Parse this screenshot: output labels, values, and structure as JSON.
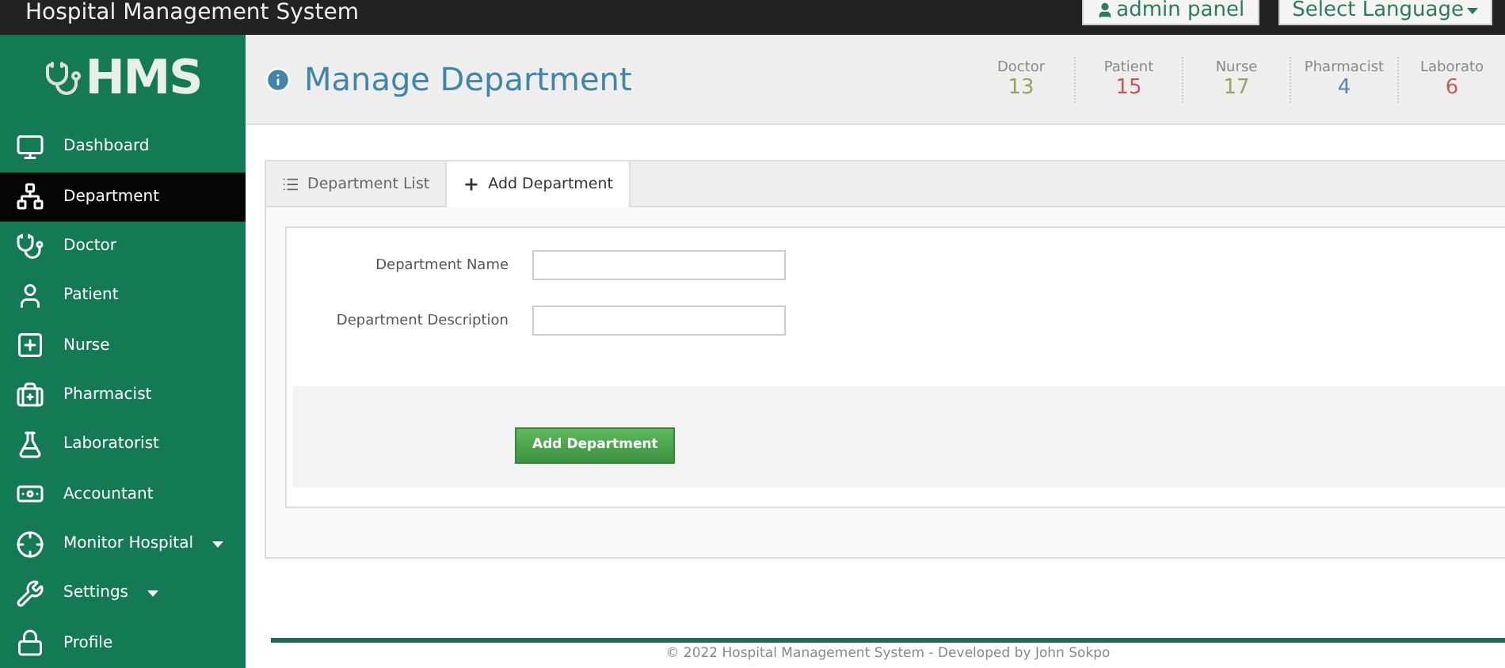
{
  "top_bar": {
    "title": "Hospital Management System",
    "buttons": [
      {
        "label": "admin panel",
        "kind": "user"
      },
      {
        "label": "Select Language",
        "kind": "dropdown"
      }
    ]
  },
  "sidebar": {
    "logo": "HMS",
    "items": [
      {
        "label": "Dashboard",
        "selected": false,
        "has_dropdown": false
      },
      {
        "label": "Department",
        "selected": true,
        "has_dropdown": false
      },
      {
        "label": "Doctor",
        "selected": false,
        "has_dropdown": false
      },
      {
        "label": "Patient",
        "selected": false,
        "has_dropdown": false
      },
      {
        "label": "Nurse",
        "selected": false,
        "has_dropdown": false
      },
      {
        "label": "Pharmacist",
        "selected": false,
        "has_dropdown": false
      },
      {
        "label": "Laboratorist",
        "selected": false,
        "has_dropdown": false
      },
      {
        "label": "Accountant",
        "selected": false,
        "has_dropdown": false
      },
      {
        "label": "Monitor Hospital",
        "selected": false,
        "has_dropdown": true
      },
      {
        "label": "Settings",
        "selected": false,
        "has_dropdown": true
      },
      {
        "label": "Profile",
        "selected": false,
        "has_dropdown": false
      }
    ]
  },
  "header": {
    "title": "Manage Department",
    "stats": [
      {
        "label": "Doctor",
        "value": "13",
        "color": "#9ba35c"
      },
      {
        "label": "Patient",
        "value": "15",
        "color": "#c4595c"
      },
      {
        "label": "Nurse",
        "value": "17",
        "color": "#9ba35c"
      },
      {
        "label": "Pharmacist",
        "value": "4",
        "color": "#5b86ab"
      },
      {
        "label": "Laborato",
        "value": "6",
        "color": "#c4595c"
      }
    ]
  },
  "tabs": [
    {
      "label": "Department List",
      "selected": false,
      "kind": "list"
    },
    {
      "label": "Add Department",
      "selected": true,
      "kind": "add"
    }
  ],
  "form": {
    "fields": [
      {
        "label": "Department Name"
      },
      {
        "label": "Department Description"
      }
    ],
    "submit": "Add Department"
  },
  "footer": "© 2022 Hospital Management System - Developed by John Sokpo"
}
